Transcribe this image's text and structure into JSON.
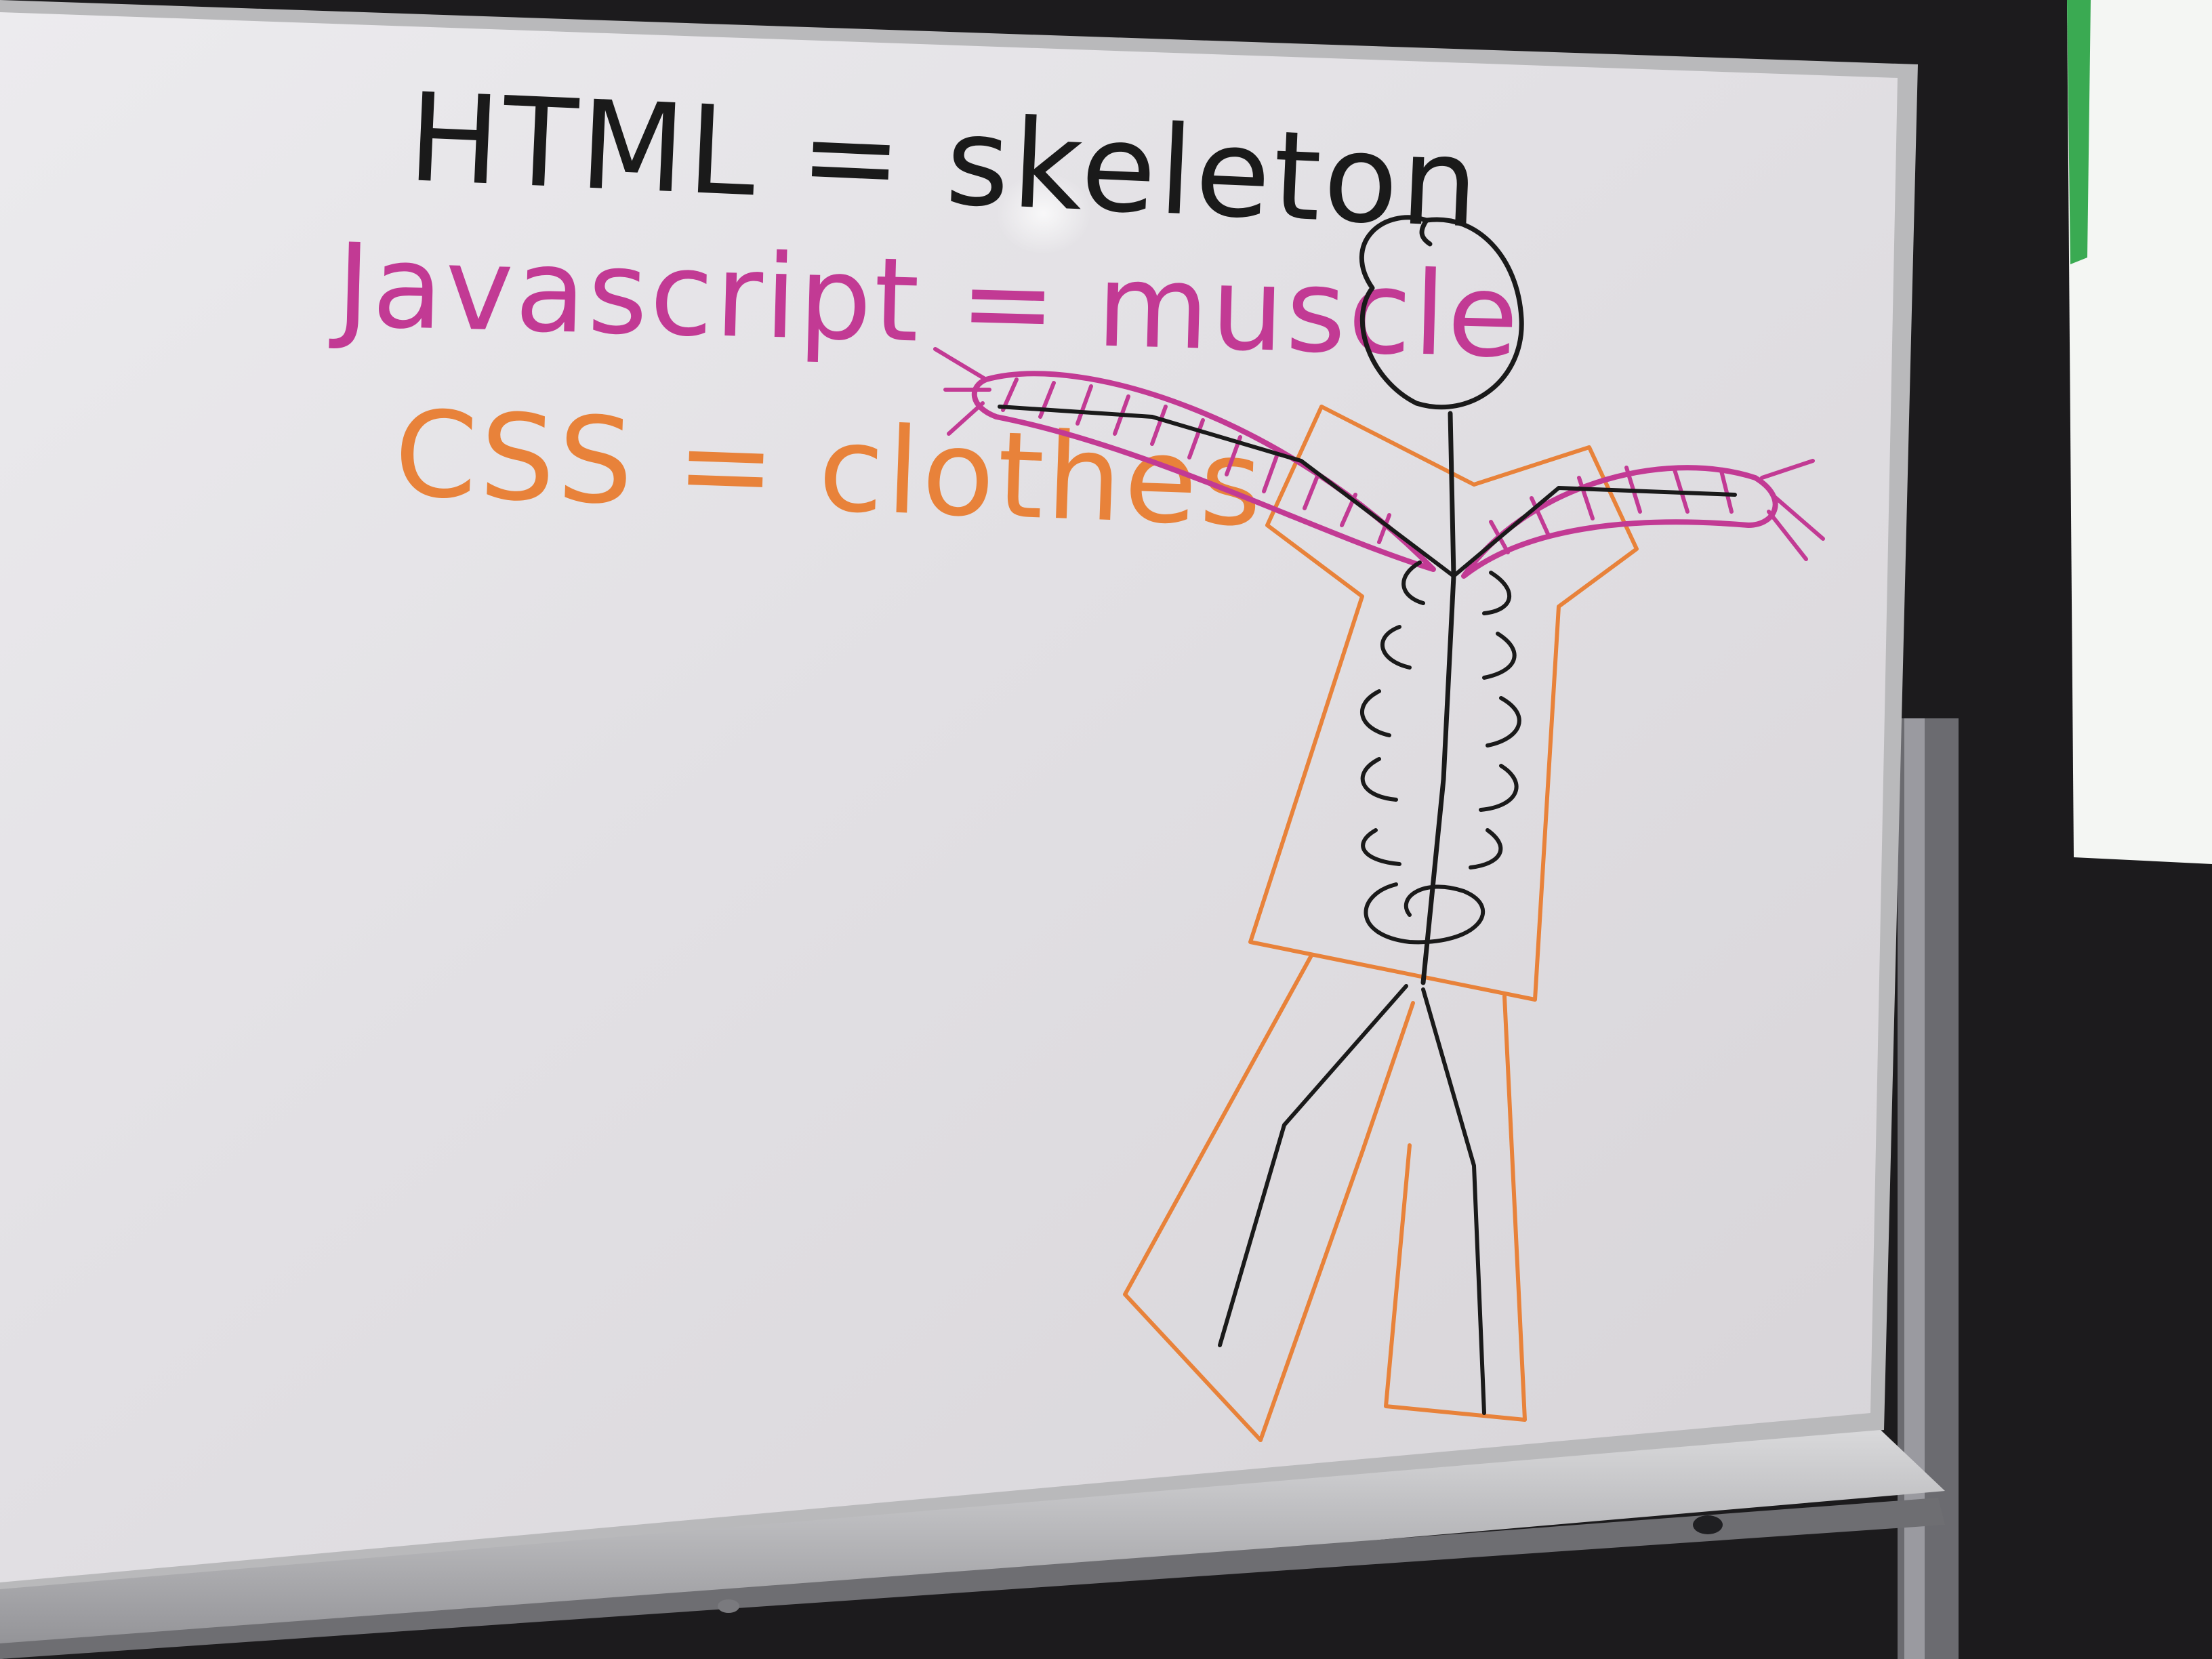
{
  "whiteboard": {
    "line_html": "HTML = skeleton",
    "line_js": "Javascript = muscle",
    "line_css": "CSS = clothes"
  },
  "colors": {
    "background": "#1c1b1d",
    "board_surface": "#e4e2e5",
    "board_frame": "#b9b9bb",
    "marker_black": "#1a1a1a",
    "marker_magenta": "#c23a94",
    "marker_orange": "#e8823a",
    "projector_screen": "#f4f6f3",
    "screen_accent": "#3aaa52"
  }
}
